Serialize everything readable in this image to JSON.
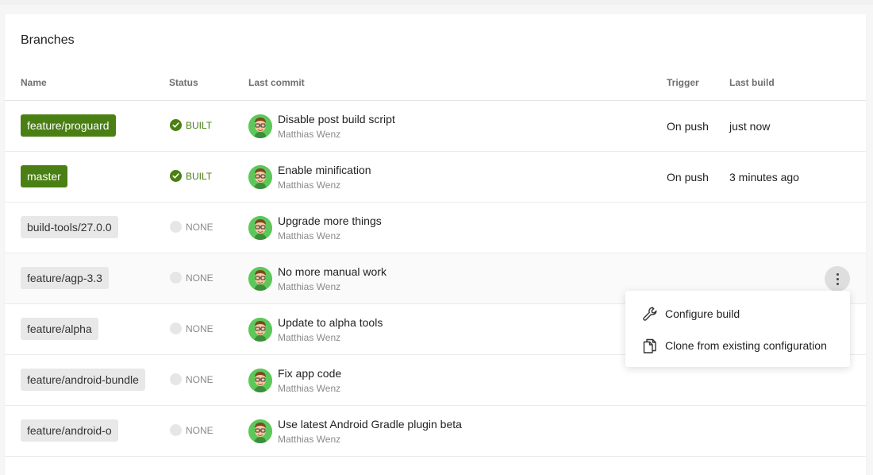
{
  "card": {
    "title": "Branches"
  },
  "columns": {
    "name": "Name",
    "status": "Status",
    "last_commit": "Last commit",
    "trigger": "Trigger",
    "last_build": "Last build"
  },
  "rows": [
    {
      "branch": "feature/proguard",
      "status": "BUILT",
      "status_kind": "built",
      "commit": "Disable post build script",
      "author": "Matthias Wenz",
      "trigger": "On push",
      "last_build": "just now"
    },
    {
      "branch": "master",
      "status": "BUILT",
      "status_kind": "built",
      "commit": "Enable minification",
      "author": "Matthias Wenz",
      "trigger": "On push",
      "last_build": "3 minutes ago"
    },
    {
      "branch": "build-tools/27.0.0",
      "status": "NONE",
      "status_kind": "none",
      "commit": "Upgrade more things",
      "author": "Matthias Wenz",
      "trigger": "",
      "last_build": ""
    },
    {
      "branch": "feature/agp-3.3",
      "status": "NONE",
      "status_kind": "none",
      "commit": "No more manual work",
      "author": "Matthias Wenz",
      "trigger": "",
      "last_build": ""
    },
    {
      "branch": "feature/alpha",
      "status": "NONE",
      "status_kind": "none",
      "commit": "Update to alpha tools",
      "author": "Matthias Wenz",
      "trigger": "",
      "last_build": ""
    },
    {
      "branch": "feature/android-bundle",
      "status": "NONE",
      "status_kind": "none",
      "commit": "Fix app code",
      "author": "Matthias Wenz",
      "trigger": "",
      "last_build": ""
    },
    {
      "branch": "feature/android-o",
      "status": "NONE",
      "status_kind": "none",
      "commit": "Use latest Android Gradle plugin beta",
      "author": "Matthias Wenz",
      "trigger": "",
      "last_build": ""
    }
  ],
  "context_menu": {
    "items": [
      {
        "label": "Configure build",
        "icon": "wrench-icon"
      },
      {
        "label": "Clone from existing configuration",
        "icon": "copy-icon"
      }
    ]
  },
  "colors": {
    "built": "#4a7f14",
    "none_badge": "#e8e8e8",
    "avatar": "#5cc85a"
  }
}
